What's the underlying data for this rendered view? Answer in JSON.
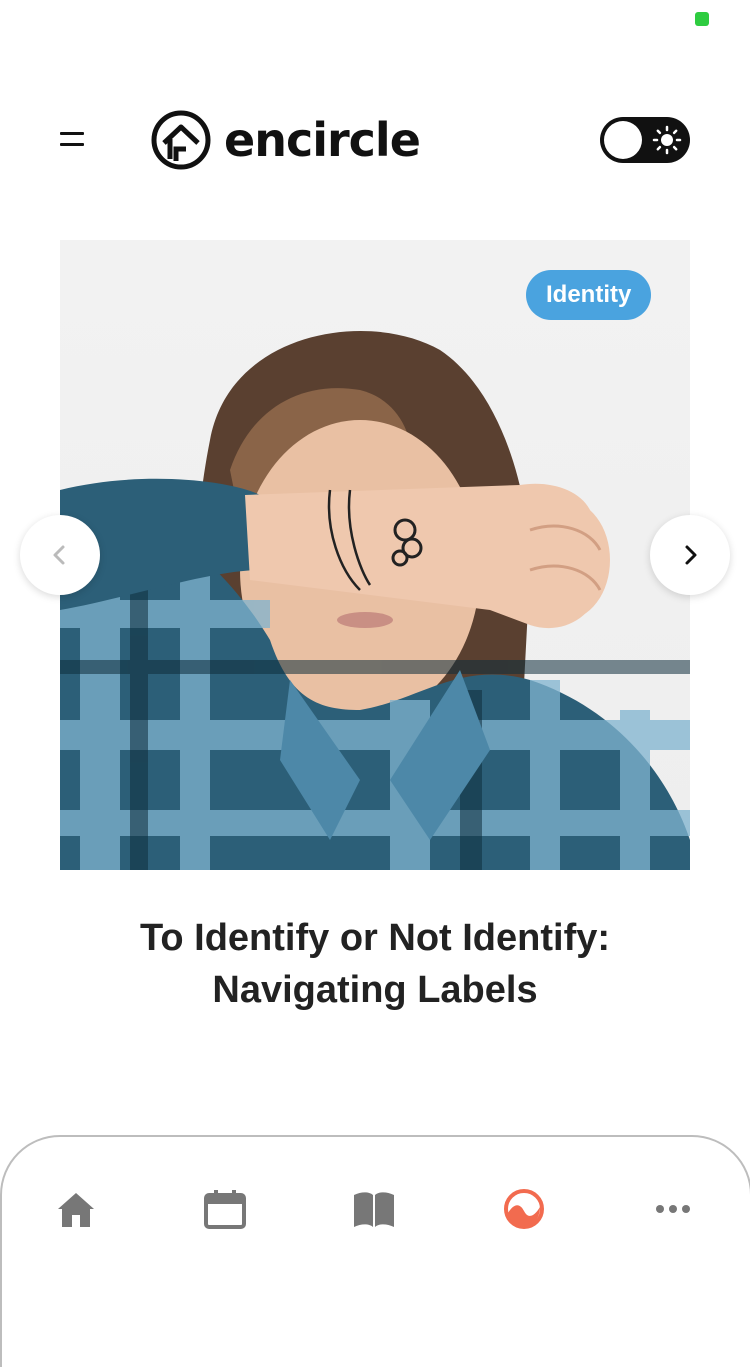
{
  "app": {
    "brand_name": "encircle"
  },
  "header": {
    "menu_icon": "hamburger-icon",
    "theme_toggle": {
      "state": "light",
      "icon": "sun-icon"
    }
  },
  "carousel": {
    "tag": "Identity",
    "tag_color": "#4aa3df",
    "image_description": "person covering eyes with tattooed wrist wearing a blue plaid shirt",
    "prev_icon": "chevron-left-icon",
    "next_icon": "chevron-right-icon",
    "title_line1": "To Identify or Not Identify:",
    "title_line2": "Navigating Labels"
  },
  "bottom_nav": {
    "items": [
      {
        "icon": "home-icon",
        "active": false
      },
      {
        "icon": "calendar-icon",
        "active": false
      },
      {
        "icon": "book-icon",
        "active": false
      },
      {
        "icon": "feed-icon",
        "active": true
      },
      {
        "icon": "more-icon",
        "active": false
      }
    ],
    "active_color": "#f26b4f",
    "inactive_color": "#777777"
  }
}
